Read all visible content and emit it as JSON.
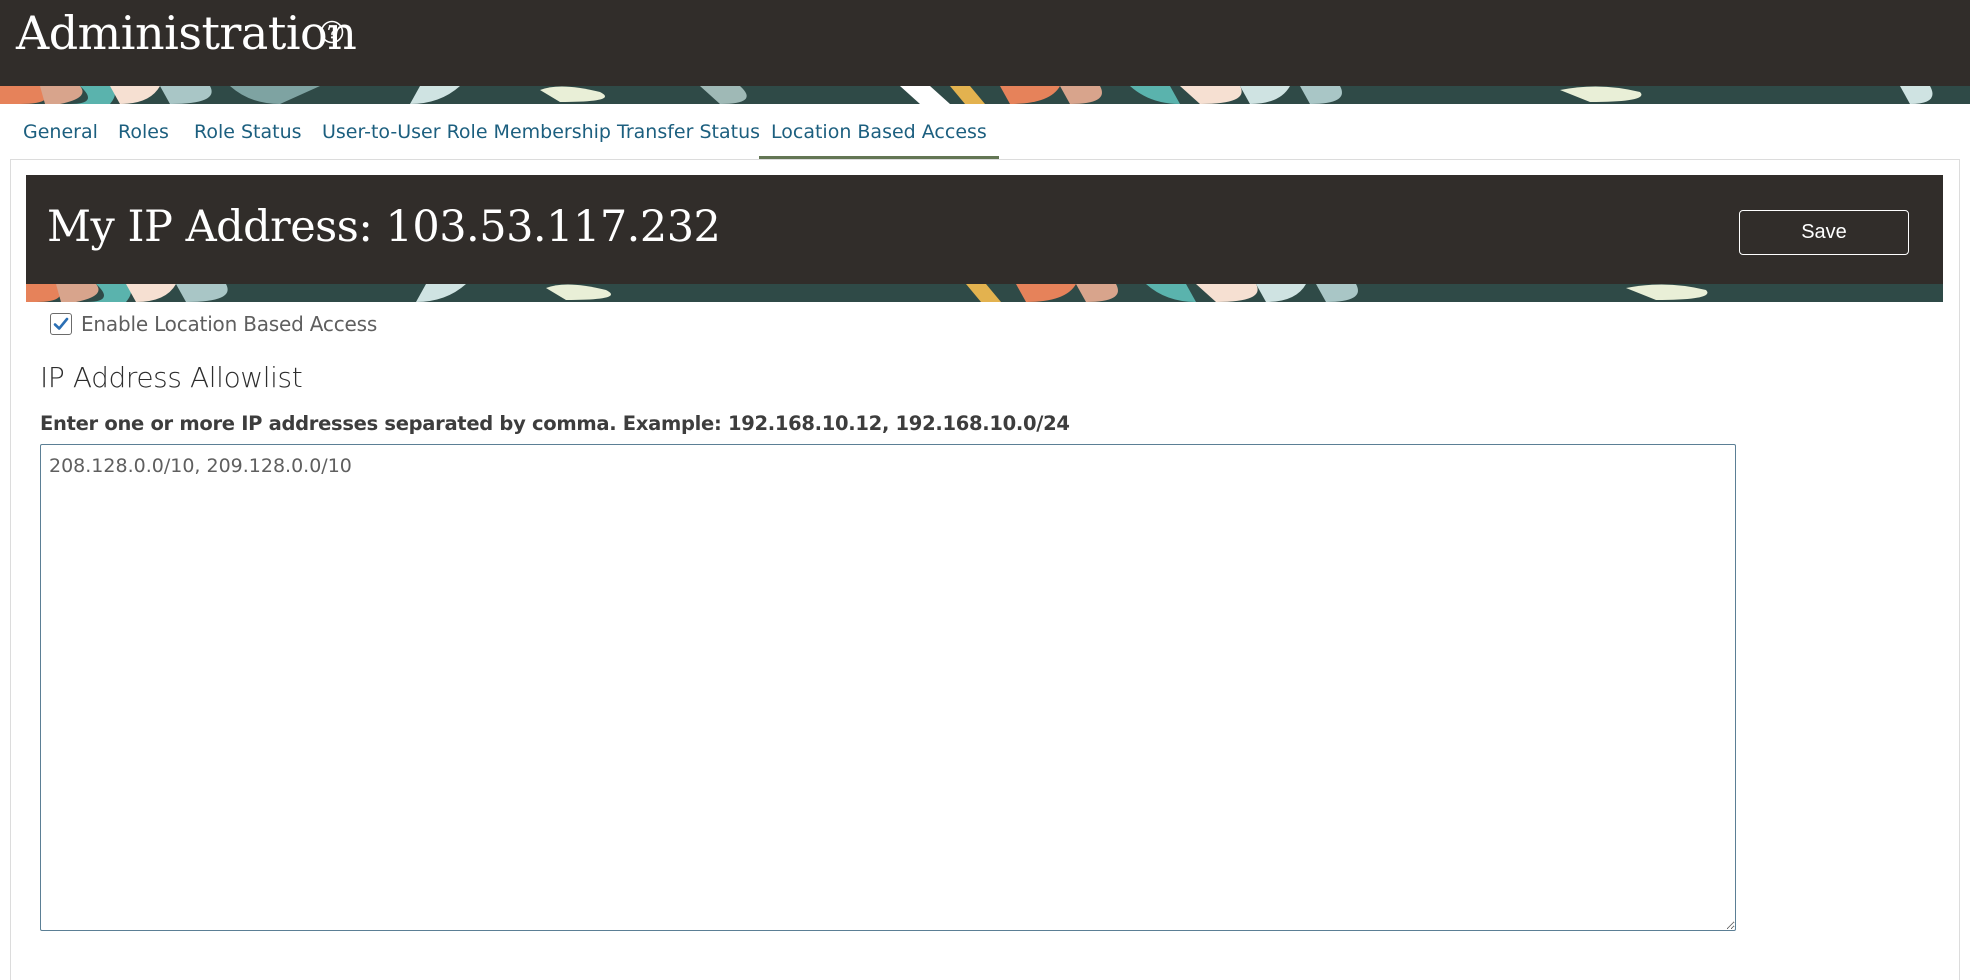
{
  "app": {
    "title": "Administration",
    "help_icon": "help-circle-icon"
  },
  "tabs": [
    {
      "label": "General",
      "active": false
    },
    {
      "label": "Roles",
      "active": false
    },
    {
      "label": "Role Status",
      "active": false
    },
    {
      "label": "User-to-User Role Membership Transfer Status",
      "active": false
    },
    {
      "label": "Location Based Access",
      "active": true
    }
  ],
  "header": {
    "ip_title": "My IP Address: 103.53.117.232",
    "save_label": "Save"
  },
  "location_access": {
    "enable_label": "Enable Location Based Access",
    "enabled": true,
    "section_title": "IP Address Allowlist",
    "field_label": "Enter one or more IP addresses separated by comma. Example: 192.168.10.12, 192.168.10.0/24",
    "allowlist_value": "208.128.0.0/10, 209.128.0.0/10"
  },
  "colors": {
    "header_bg": "#312d2a",
    "tab_link": "#1c5f7f",
    "tab_active_underline": "#637654",
    "checkbox_check": "#2b6fb4"
  }
}
